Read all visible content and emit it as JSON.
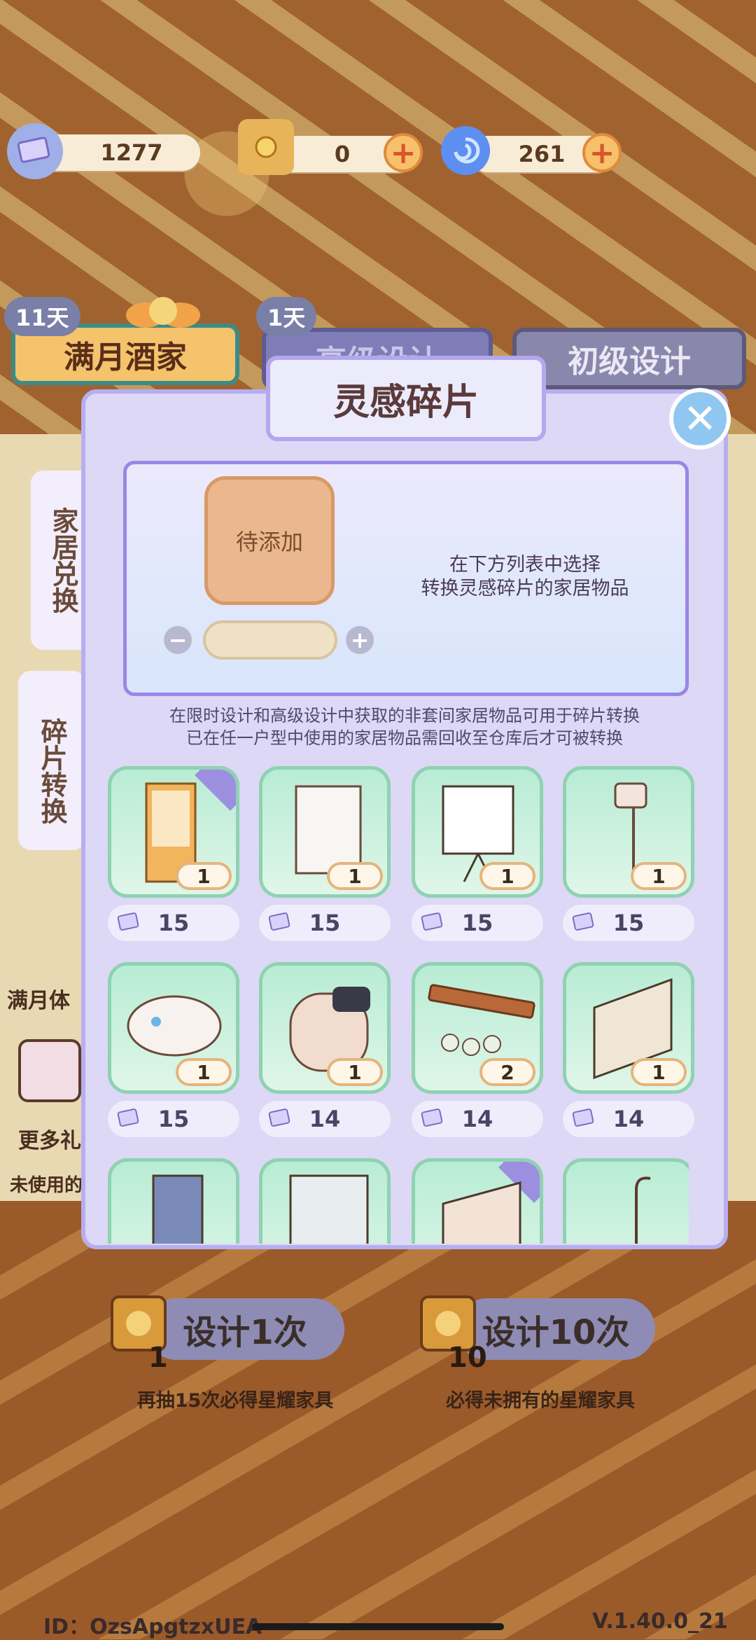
{
  "currency": [
    {
      "icon": "shard-icon",
      "value": "1277"
    },
    {
      "icon": "scroll-coin-icon",
      "value": "0"
    },
    {
      "icon": "swirl-gem-icon",
      "value": "261"
    }
  ],
  "top_tabs": [
    {
      "days": "11天",
      "label": "满月酒家"
    },
    {
      "days": "1天",
      "label": "高级设计"
    },
    {
      "days": "",
      "label": "初级设计"
    }
  ],
  "side_tabs": [
    {
      "label": "家居兑换"
    },
    {
      "label": "碎片转换"
    }
  ],
  "left_partial": {
    "a": "满月体",
    "b": "更多礼",
    "c": "未使用的"
  },
  "modal": {
    "title": "灵感碎片",
    "pending_label": "待添加",
    "hint_line1": "在下方列表中选择",
    "hint_line2": "转换灵感碎片的家居物品",
    "note_line1": "在限时设计和高级设计中获取的非套间家居物品可用于碎片转换",
    "note_line2": "已在任一户型中使用的家居物品需回收至仓库后才可被转换"
  },
  "items": [
    {
      "name": "vending-cabinet",
      "count": "1",
      "cost": "15",
      "tagged": true
    },
    {
      "name": "wall-screen",
      "count": "1",
      "cost": "15",
      "tagged": false
    },
    {
      "name": "projector-screen",
      "count": "1",
      "cost": "15",
      "tagged": false
    },
    {
      "name": "floor-lamp",
      "count": "1",
      "cost": "15",
      "tagged": false
    },
    {
      "name": "robot-vacuum",
      "count": "1",
      "cost": "15",
      "tagged": false
    },
    {
      "name": "smart-toilet",
      "count": "1",
      "cost": "14",
      "tagged": false
    },
    {
      "name": "wine-glass-rack",
      "count": "2",
      "cost": "14",
      "tagged": false
    },
    {
      "name": "wall-mirror",
      "count": "1",
      "cost": "14",
      "tagged": false
    }
  ],
  "bottom": {
    "design_once": "设计1次",
    "once_count": "1",
    "once_sub": "再抽15次必得星耀家具",
    "design_ten": "设计10次",
    "ten_count": "10",
    "ten_sub": "必得未拥有的星耀家具"
  },
  "footer": {
    "id": "ID：OzsApgtzxUEA",
    "version": "V.1.40.0_21"
  },
  "colors": {
    "accent": "#9b86e6",
    "item_bg": "#b8ecd5",
    "plus": "#f7c06a"
  }
}
